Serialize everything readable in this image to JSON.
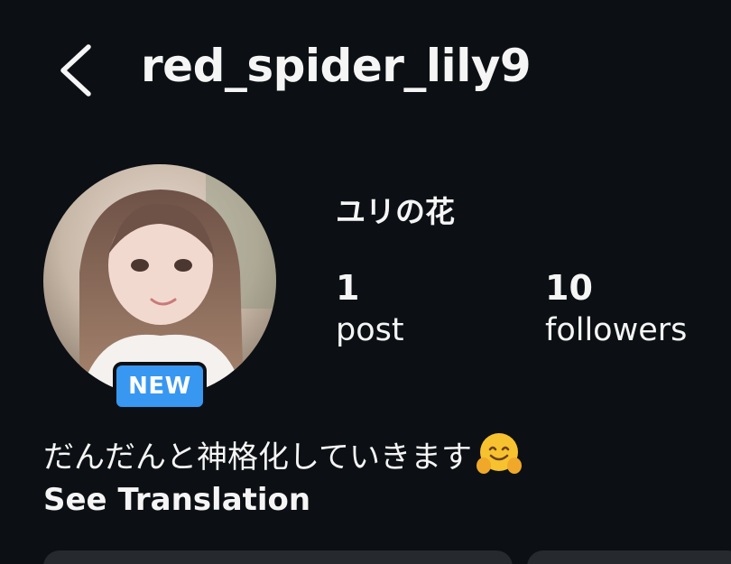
{
  "header": {
    "back_icon": "chevron-left-icon",
    "username": "red_spider_lily9"
  },
  "profile": {
    "badge": "NEW",
    "display_name": "ユリの花",
    "stats": [
      {
        "value": "1",
        "label": "post"
      },
      {
        "value": "10",
        "label": "followers"
      }
    ],
    "bio": "だんだんと神格化していきます",
    "bio_emoji_icon": "hugging-face-icon",
    "see_translation": "See Translation"
  },
  "colors": {
    "background": "#0c1014",
    "text": "#f5f5f5",
    "badge": "#3897f0",
    "button": "#262a2f"
  }
}
